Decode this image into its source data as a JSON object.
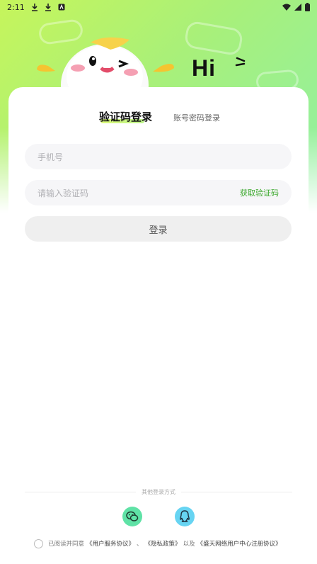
{
  "status_bar": {
    "time": "2:11",
    "icons": [
      "download-icon",
      "download-icon",
      "app-notification-icon",
      "wifi-icon",
      "signal-icon",
      "battery-icon"
    ]
  },
  "header": {
    "greeting": "Hi",
    "accent_color": "#c6f55b"
  },
  "tabs": {
    "active_label": "验证码登录",
    "inactive_label": "账号密码登录"
  },
  "form": {
    "phone_placeholder": "手机号",
    "code_placeholder": "请输入验证码",
    "get_code_label": "获取验证码",
    "login_label": "登录"
  },
  "other_login": {
    "label": "其他登录方式",
    "options": [
      {
        "name": "wechat",
        "icon": "wechat-icon",
        "color": "#5fe2a6"
      },
      {
        "name": "qq",
        "icon": "qq-icon",
        "color": "#67d4f2"
      }
    ]
  },
  "agreement": {
    "prefix": "已阅读并同意",
    "terms": "《用户服务协议》",
    "sep": "、",
    "privacy": "《隐私政策》",
    "and": "以及",
    "center": "《盛天网络用户中心注册协议》"
  }
}
